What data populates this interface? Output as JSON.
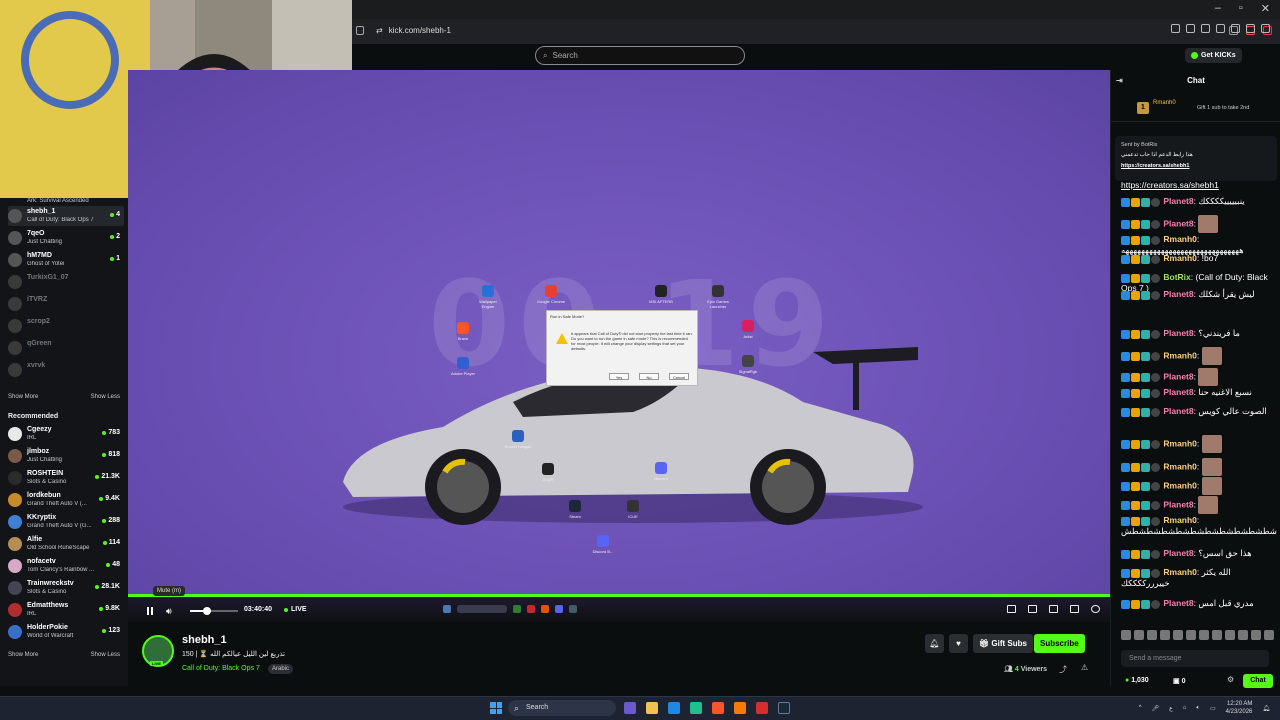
{
  "browser": {
    "url": "kick.com/shebh-1"
  },
  "header": {
    "search_placeholder": "Search",
    "get_kicks": "Get KICKs"
  },
  "sidebar": {
    "top_game": "Ark: Survival Ascended",
    "following": [
      {
        "name": "shebh_1",
        "game": "Call of Duty: Black Ops 7",
        "viewers": "4",
        "selected": true
      },
      {
        "name": "7qeO",
        "game": "Just Chatting",
        "viewers": "2"
      },
      {
        "name": "hM7MD",
        "game": "Ghost of Yotei",
        "viewers": "1"
      },
      {
        "name": "TurkixG1_07",
        "game": "",
        "viewers": "",
        "offline": true
      },
      {
        "name": "iTVRZ",
        "game": "",
        "viewers": "",
        "offline": true
      },
      {
        "name": "scrop2",
        "game": "",
        "viewers": "",
        "offline": true
      },
      {
        "name": "qGreen",
        "game": "",
        "viewers": "",
        "offline": true
      },
      {
        "name": "xvrvk",
        "game": "",
        "viewers": "",
        "offline": true
      }
    ],
    "show_more": "Show More",
    "show_less": "Show Less",
    "recommended_title": "Recommended",
    "recommended": [
      {
        "name": "Cgeezy",
        "game": "IRL",
        "viewers": "783"
      },
      {
        "name": "jlmboz",
        "game": "Just Chatting",
        "viewers": "818"
      },
      {
        "name": "ROSHTEIN",
        "game": "Slots & Casino",
        "viewers": "21.3K"
      },
      {
        "name": "lordkebun",
        "game": "Grand Theft Auto V (...",
        "viewers": "9.4K"
      },
      {
        "name": "KKryptix",
        "game": "Grand Theft Auto V (G...",
        "viewers": "288"
      },
      {
        "name": "Alfie",
        "game": "Old School RuneScape",
        "viewers": "114"
      },
      {
        "name": "nofacetv",
        "game": "Tom Clancy's Rainbow ...",
        "viewers": "48"
      },
      {
        "name": "Trainwreckstv",
        "game": "Slots & Casino",
        "viewers": "28.1K"
      },
      {
        "name": "Edmatthews",
        "game": "IRL",
        "viewers": "9.8K"
      },
      {
        "name": "HolderPokie",
        "game": "World of Warcraft",
        "viewers": "123"
      }
    ],
    "show_more2": "Show More",
    "show_less2": "Show Less"
  },
  "player": {
    "desktop_clock": "00 19",
    "dialog_title": "Run in Safe Mode?",
    "dialog_text": "It appears that Call of Duty® did not start properly the last time it ran. Do you want to run the game in safe mode? This is recommended for most people. It will change your display settings that set your defaults.",
    "dialog_buttons": [
      "Yes",
      "No",
      "Cancel"
    ],
    "desktop_icons": [
      {
        "label": "Wallpaper Engine",
        "color": "#2b6fd6"
      },
      {
        "label": "Google Chrome",
        "color": "#e34133"
      },
      {
        "label": "MSI AFTERB",
        "color": "#222"
      },
      {
        "label": "Epic Games Launcher",
        "color": "#333"
      },
      {
        "label": "Brave",
        "color": "#fb542b"
      },
      {
        "label": "Adobe Player",
        "color": "#3060d0"
      },
      {
        "label": "Artist",
        "color": "#d62060"
      },
      {
        "label": "SignalRgb",
        "color": "#444"
      },
      {
        "label": "Rocket League",
        "color": "#2b60c0"
      },
      {
        "label": "Duty®",
        "color": "#222"
      },
      {
        "label": "Discord",
        "color": "#5865f2"
      },
      {
        "label": "Steam",
        "color": "#1b2838"
      },
      {
        "label": "iCUE",
        "color": "#333"
      },
      {
        "label": "Discord B...",
        "color": "#5865f2"
      }
    ],
    "time": "03:40:40",
    "live": "LIVE",
    "tooltip": "Mute (m)",
    "volume": 0.35
  },
  "stream": {
    "channel": "shebh_1",
    "title": "150 | ⏳ تذريع لين الليل عيالكم الله",
    "category": "Call of Duty: Black Ops 7",
    "tag": "Arabic",
    "viewers_count": "4",
    "viewers_label": "Viewers",
    "gift_subs": "Gift Subs",
    "subscribe": "Subscribe",
    "live_badge": "LIVE"
  },
  "chat": {
    "title": "Chat",
    "gift_user": "Rmanh0",
    "gift_rank": "1",
    "gift_text": "Gift 1 sub to take 2nd",
    "pinned_header": "Sent by BotRix",
    "pinned_body": "هذا رابط الدعم اذا حاب تدعمني",
    "pinned_link": "https://creators.sa/shebh1",
    "link_line": "https://creators.sa/shebh1",
    "messages": [
      {
        "user": "Planet8",
        "cls": "planet",
        "text": "ينبيييييككككك"
      },
      {
        "user": "Planet8",
        "cls": "planet",
        "text": "",
        "emote": true
      },
      {
        "user": "Rmanh0",
        "cls": "rman",
        "text": "ههههههههههههههههههههههههههههههه"
      },
      {
        "user": "Rmanh0",
        "cls": "rman",
        "text": "!bo7"
      },
      {
        "user": "BotRix",
        "cls": "bot",
        "text": "(Call of Duty: Black Ops 7 )"
      },
      {
        "user": "Planet8",
        "cls": "planet",
        "text": "ليش يقرأ شكلك"
      },
      {
        "user": "Planet8",
        "cls": "planet",
        "text": "ما فريندني؟"
      },
      {
        "user": "Rmanh0",
        "cls": "rman",
        "text": "",
        "emote": true
      },
      {
        "user": "Planet8",
        "cls": "planet",
        "text": "",
        "emote": true
      },
      {
        "user": "Planet8",
        "cls": "planet",
        "text": "نسبع الاغنيه حنا"
      },
      {
        "user": "Planet8",
        "cls": "planet",
        "text": "الصوت عالي كويس"
      },
      {
        "user": "Rmanh0",
        "cls": "rman",
        "text": "",
        "emote": true
      },
      {
        "user": "Rmanh0",
        "cls": "rman",
        "text": "",
        "emote": true
      },
      {
        "user": "Rmanh0",
        "cls": "rman",
        "text": "",
        "emote": true
      },
      {
        "user": "Planet8",
        "cls": "planet",
        "text": "",
        "emote": true
      },
      {
        "user": "Rmanh0",
        "cls": "rman",
        "text": "شطشطشطشطشطشطشطشطشطشطش"
      },
      {
        "user": "Planet8",
        "cls": "planet",
        "text": "هذا حق اسس؟"
      },
      {
        "user": "Rmanh0",
        "cls": "rman",
        "text": "الله يكثر خييرررككككك"
      },
      {
        "user": "Planet8",
        "cls": "planet",
        "text": "مدري قبل امس"
      }
    ],
    "send_placeholder": "Send a message",
    "kicks_balance": "1,030",
    "subs_balance": "0",
    "chat_button": "Chat"
  },
  "taskbar": {
    "search": "Search",
    "time": "12:20 AM",
    "date": "4/23/2026"
  },
  "colors": {
    "accent": "#53fc18",
    "player_bg": "#6f52b6"
  }
}
